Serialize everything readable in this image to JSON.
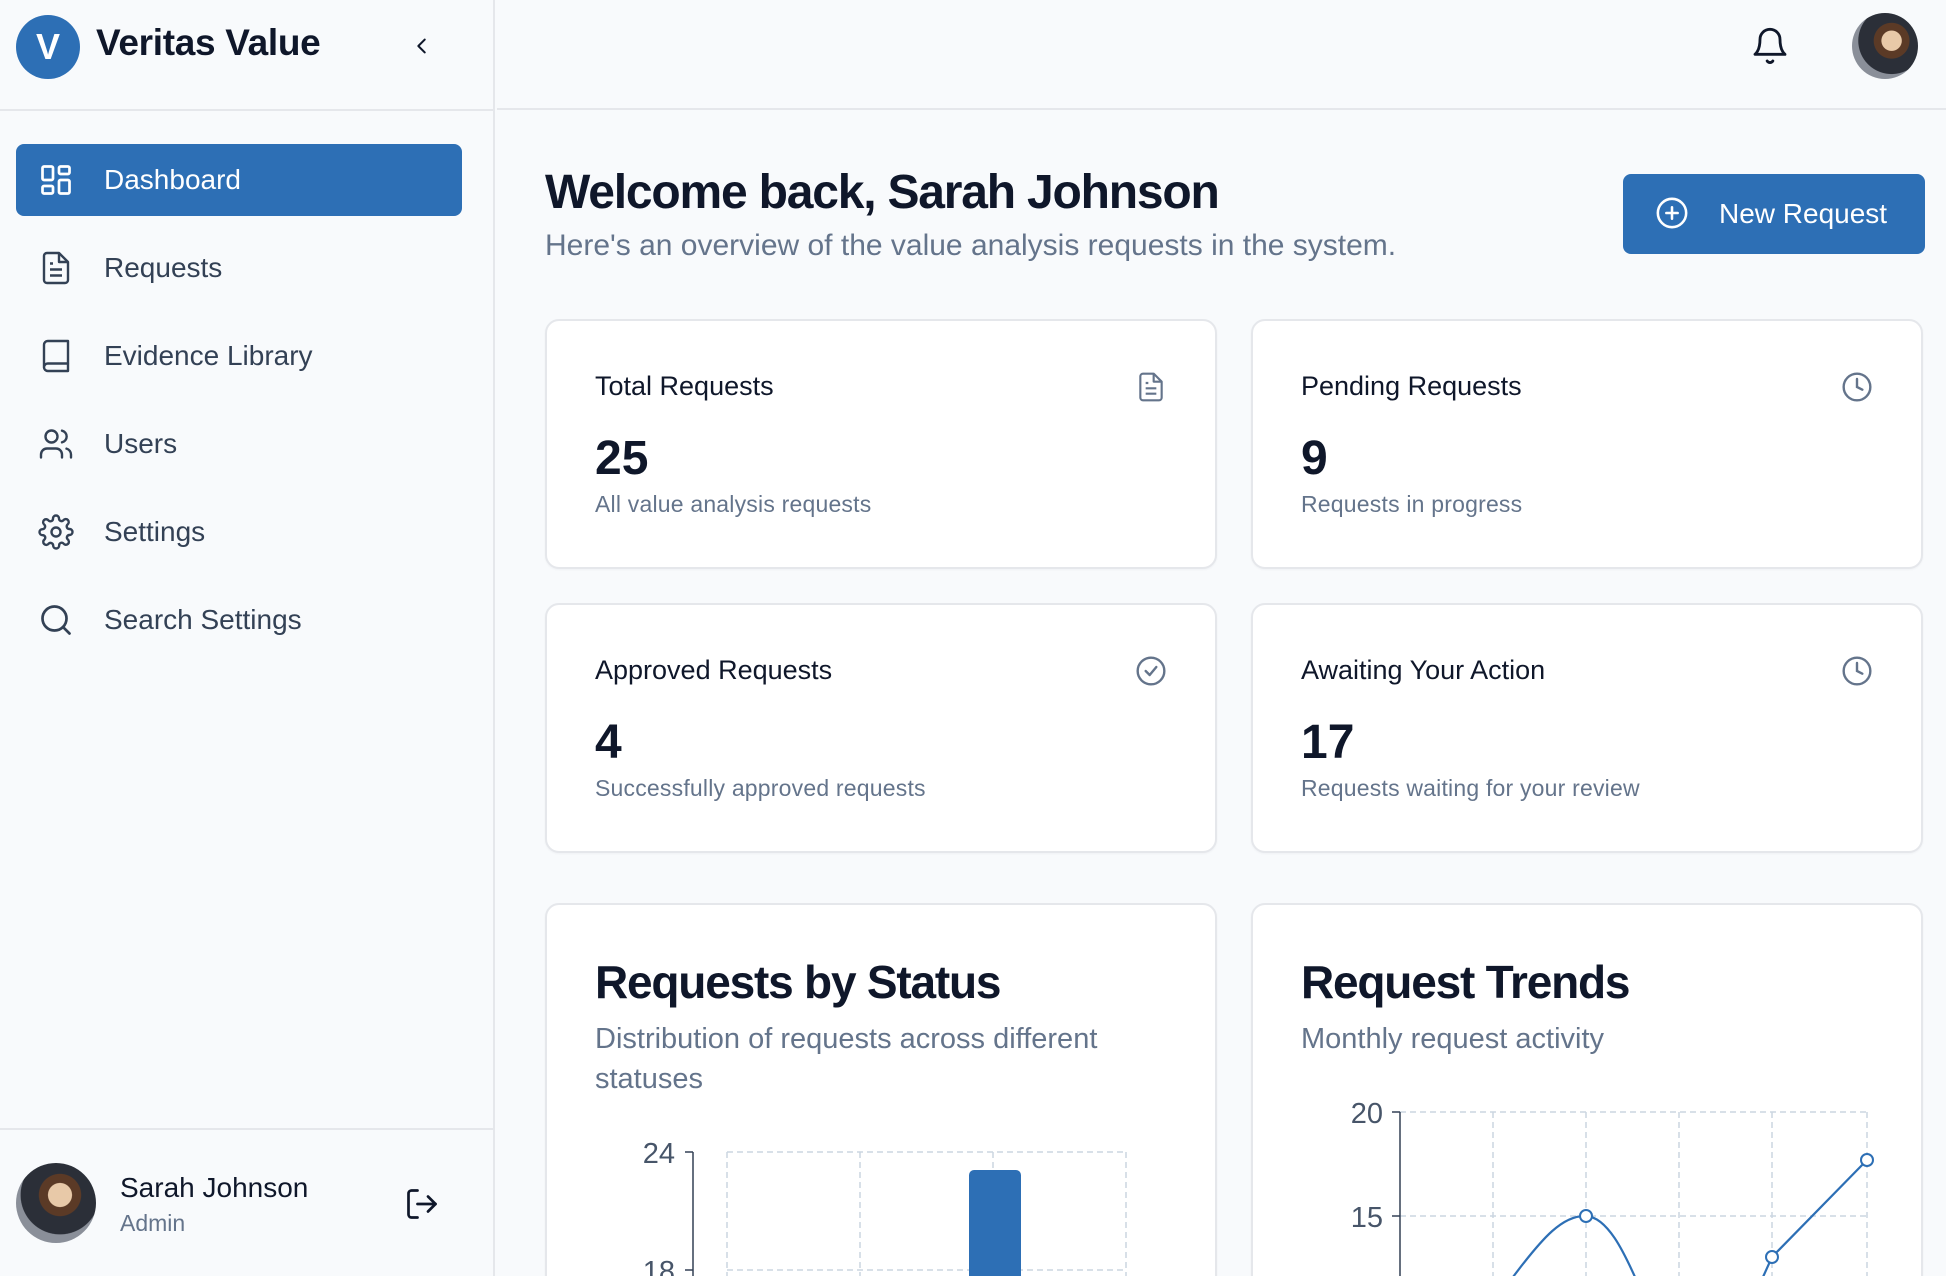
{
  "brand": {
    "initial": "V",
    "name": "Veritas Value"
  },
  "sidebar": {
    "items": [
      {
        "label": "Dashboard",
        "icon": "dashboard-grid-icon",
        "active": true
      },
      {
        "label": "Requests",
        "icon": "file-text-icon",
        "active": false
      },
      {
        "label": "Evidence Library",
        "icon": "book-icon",
        "active": false
      },
      {
        "label": "Users",
        "icon": "users-icon",
        "active": false
      },
      {
        "label": "Settings",
        "icon": "gear-icon",
        "active": false
      },
      {
        "label": "Search Settings",
        "icon": "search-icon",
        "active": false
      }
    ]
  },
  "user": {
    "name": "Sarah Johnson",
    "role": "Admin"
  },
  "main": {
    "welcome_title": "Welcome back, Sarah Johnson",
    "welcome_subtitle": "Here's an overview of the value analysis requests in the system.",
    "new_request_label": "New Request"
  },
  "stats": [
    {
      "title": "Total Requests",
      "value": "25",
      "desc": "All value analysis requests",
      "icon": "file-text-icon"
    },
    {
      "title": "Pending Requests",
      "value": "9",
      "desc": "Requests in progress",
      "icon": "clock-icon"
    },
    {
      "title": "Approved Requests",
      "value": "4",
      "desc": "Successfully approved requests",
      "icon": "check-circle-icon"
    },
    {
      "title": "Awaiting Your Action",
      "value": "17",
      "desc": "Requests waiting for your review",
      "icon": "clock-icon"
    }
  ],
  "charts": {
    "status": {
      "title": "Requests by Status",
      "subtitle": "Distribution of requests across different statuses"
    },
    "trends": {
      "title": "Request Trends",
      "subtitle": "Monthly request activity"
    }
  },
  "colors": {
    "accent": "#2d6fb5",
    "muted": "#64748b",
    "border": "#e5e7eb"
  },
  "chart_data": [
    {
      "type": "bar",
      "title": "Requests by Status",
      "yticks": [
        24,
        18
      ],
      "values": [
        null,
        null,
        23,
        null
      ],
      "note": "partially visible; only one bar top shown"
    },
    {
      "type": "line",
      "title": "Request Trends",
      "yticks": [
        20,
        15
      ],
      "points": [
        {
          "x": 2,
          "y": 15
        },
        {
          "x": 4,
          "y": 14
        },
        {
          "x": 5,
          "y": 18
        }
      ]
    }
  ]
}
